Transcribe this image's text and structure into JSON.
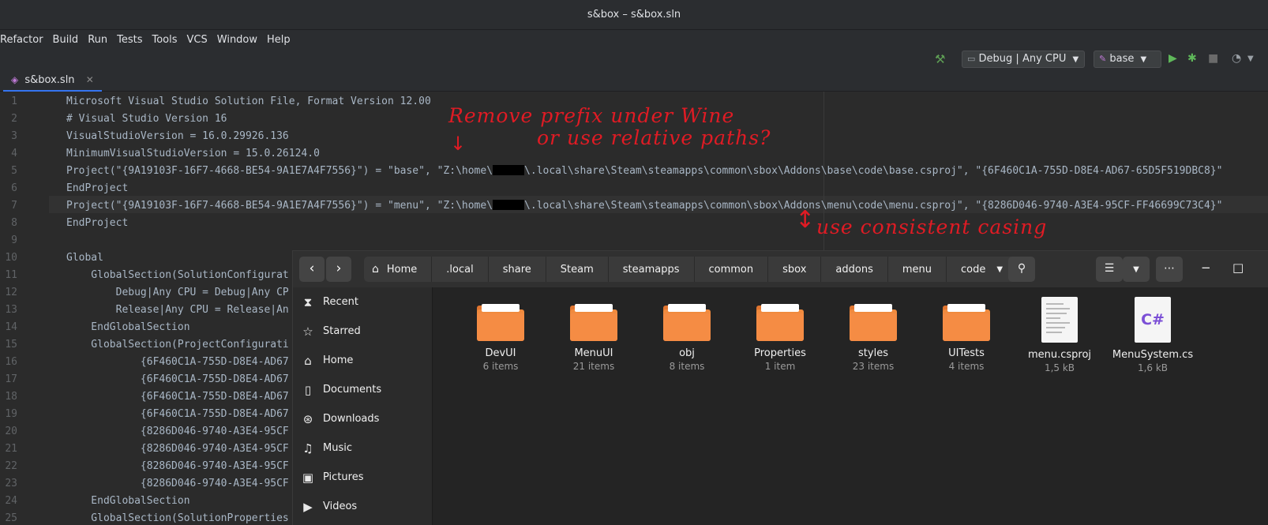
{
  "window": {
    "title": "s&box – s&box.sln"
  },
  "menu": [
    "Refactor",
    "Build",
    "Run",
    "Tests",
    "Tools",
    "VCS",
    "Window",
    "Help"
  ],
  "toolbar": {
    "config": "Debug | Any CPU",
    "run_target": "base"
  },
  "tab": {
    "label": "s&box.sln"
  },
  "editor": {
    "lines": [
      {
        "n": "1",
        "text": "Microsoft Visual Studio Solution File, Format Version 12.00"
      },
      {
        "n": "2",
        "text": "# Visual Studio Version 16"
      },
      {
        "n": "3",
        "text": "VisualStudioVersion = 16.0.29926.136"
      },
      {
        "n": "4",
        "text": "MinimumVisualStudioVersion = 15.0.26124.0"
      },
      {
        "n": "5",
        "a": "Project(\"{9A19103F-16F7-4668-BE54-9A1E7A4F7556}\") = \"base\", \"Z:\\home\\",
        "b": "\\.local\\share\\Steam\\steamapps\\common\\sbox\\Addons\\base\\code\\base.csproj\", \"{6F460C1A-755D-D8E4-AD67-65D5F519DBC8}\""
      },
      {
        "n": "6",
        "text": "EndProject"
      },
      {
        "n": "7",
        "a": "Project(\"{9A19103F-16F7-4668-BE54-9A1E7A4F7556}\") = \"menu\", \"Z:\\home\\",
        "b": "\\.local\\share\\Steam\\steamapps\\common\\sbox\\Addons\\menu\\code\\menu.csproj\", \"{8286D046-9740-A3E4-95CF-FF46699C73C4}\""
      },
      {
        "n": "8",
        "text": "EndProject"
      },
      {
        "n": "9",
        "text": ""
      },
      {
        "n": "10",
        "text": "Global"
      },
      {
        "n": "11",
        "text": "    GlobalSection(SolutionConfigurat"
      },
      {
        "n": "12",
        "text": "        Debug|Any CPU = Debug|Any CP"
      },
      {
        "n": "13",
        "text": "        Release|Any CPU = Release|An"
      },
      {
        "n": "14",
        "text": "    EndGlobalSection"
      },
      {
        "n": "15",
        "text": "    GlobalSection(ProjectConfigurati"
      },
      {
        "n": "16",
        "text": "            {6F460C1A-755D-D8E4-AD67"
      },
      {
        "n": "17",
        "text": "            {6F460C1A-755D-D8E4-AD67"
      },
      {
        "n": "18",
        "text": "            {6F460C1A-755D-D8E4-AD67"
      },
      {
        "n": "19",
        "text": "            {6F460C1A-755D-D8E4-AD67"
      },
      {
        "n": "20",
        "text": "            {8286D046-9740-A3E4-95CF"
      },
      {
        "n": "21",
        "text": "            {8286D046-9740-A3E4-95CF"
      },
      {
        "n": "22",
        "text": "            {8286D046-9740-A3E4-95CF"
      },
      {
        "n": "23",
        "text": "            {8286D046-9740-A3E4-95CF"
      },
      {
        "n": "24",
        "text": "    EndGlobalSection"
      },
      {
        "n": "25",
        "text": "    GlobalSection(SolutionProperties"
      }
    ]
  },
  "annotations": {
    "line1": "Remove prefix under Wine",
    "line2": "or use relative paths?",
    "line3": "use consistent casing"
  },
  "filemanager": {
    "path": [
      "Home",
      ".local",
      "share",
      "Steam",
      "steamapps",
      "common",
      "sbox",
      "addons",
      "menu",
      "code"
    ],
    "sidebar": [
      {
        "icon": "recent-icon",
        "label": "Recent"
      },
      {
        "icon": "star-icon",
        "label": "Starred"
      },
      {
        "icon": "home-icon",
        "label": "Home"
      },
      {
        "icon": "document-icon",
        "label": "Documents"
      },
      {
        "icon": "download-icon",
        "label": "Downloads"
      },
      {
        "icon": "music-icon",
        "label": "Music"
      },
      {
        "icon": "pictures-icon",
        "label": "Pictures"
      },
      {
        "icon": "videos-icon",
        "label": "Videos"
      }
    ],
    "items": [
      {
        "kind": "folder",
        "name": "DevUI",
        "meta": "6 items"
      },
      {
        "kind": "folder",
        "name": "MenuUI",
        "meta": "21 items"
      },
      {
        "kind": "folder",
        "name": "obj",
        "meta": "8 items"
      },
      {
        "kind": "folder",
        "name": "Properties",
        "meta": "1 item"
      },
      {
        "kind": "folder",
        "name": "styles",
        "meta": "23 items"
      },
      {
        "kind": "folder",
        "name": "UITests",
        "meta": "4 items"
      },
      {
        "kind": "file",
        "name": "menu.csproj",
        "meta": "1,5 kB"
      },
      {
        "kind": "csharp",
        "name": "MenuSystem.cs",
        "meta": "1,6 kB",
        "badge": "C#"
      }
    ]
  },
  "colors": {
    "folder": "#f08a3e",
    "annotation": "#e01b24",
    "accent": "#3574f0"
  }
}
